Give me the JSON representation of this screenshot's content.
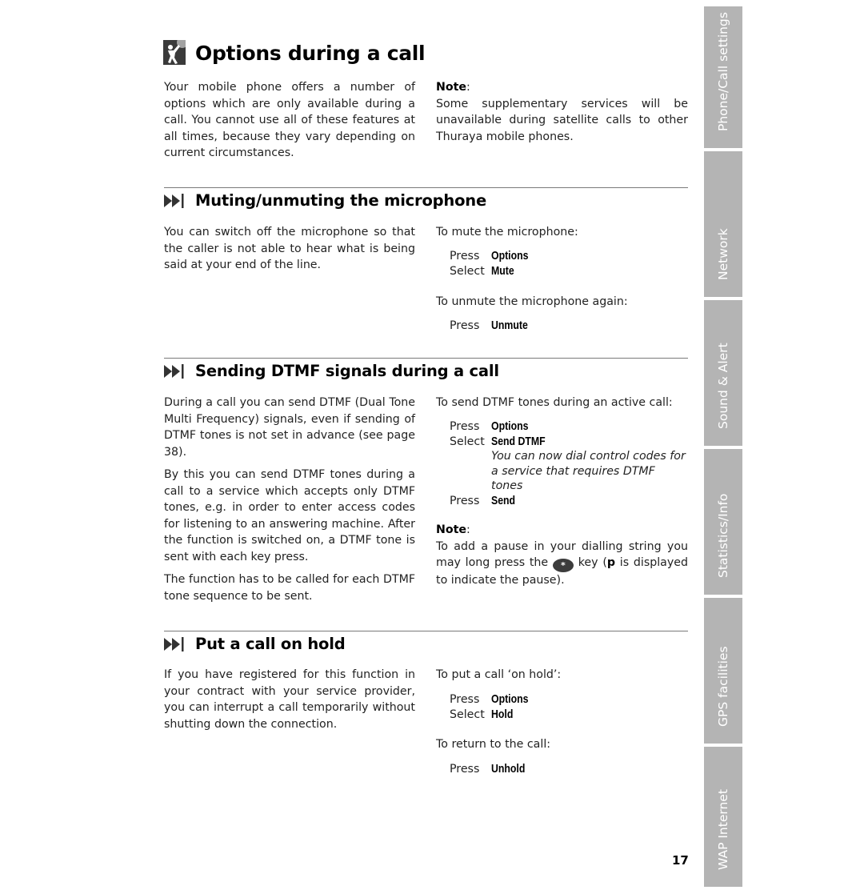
{
  "page": {
    "title": "Options during a call",
    "title_icon": "person-waving-icon",
    "page_number": "17",
    "intro": "Your mobile phone offers a number of options which are only available during a call. You cannot use all of these features at all times, because they vary depending on current circumstances.",
    "intro_note": {
      "label": "Note",
      "text": "Some supplementary services will be unavailable during satellite calls to other Thuraya mobile phones."
    }
  },
  "sections": [
    {
      "title": "Muting/unmuting the microphone",
      "icon": "fast-forward-end-icon",
      "body": [
        "You can switch off the microphone so that the caller is not able to hear what is being said at your end of the line."
      ],
      "procedures": [
        {
          "intro": "To mute the microphone:",
          "steps": [
            {
              "verb": "Press",
              "key": "Options"
            },
            {
              "verb": "Select",
              "key": "Mute"
            }
          ]
        },
        {
          "intro": "To unmute the microphone again:",
          "steps": [
            {
              "verb": "Press",
              "key": "Unmute"
            }
          ]
        }
      ]
    },
    {
      "title": "Sending DTMF signals during a call",
      "icon": "fast-forward-end-icon",
      "body": [
        "During a call you can send DTMF (Dual Tone Multi Frequency) signals, even if sending of DTMF tones is not set in advance (see page 38).",
        "By this you can send DTMF tones during a call to a service which accepts only DTMF tones, e.g. in order to enter access codes for listening to an answering machine. After the function is switched on, a DTMF tone is sent with each key press.",
        "The function has to be called for each DTMF tone sequence to be sent."
      ],
      "procedures": [
        {
          "intro": "To send DTMF tones during an active call:",
          "steps": [
            {
              "verb": "Press",
              "key": "Options"
            },
            {
              "verb": "Select",
              "key": "Send DTMF"
            },
            {
              "note": "You can now dial control codes for a service that requires DTMF tones"
            },
            {
              "verb": "Press",
              "key": "Send"
            }
          ]
        }
      ],
      "note": {
        "label": "Note",
        "text_before": "To add a pause in your dialling string you may long press the",
        "key_symbol": "*",
        "text_middle": "key (",
        "bold_char": "p",
        "text_after": "is displayed to indicate the pause)."
      }
    },
    {
      "title": "Put a call on hold",
      "icon": "fast-forward-end-icon",
      "body": [
        "If you have registered for this function in your contract with your service provider, you can interrupt a call temporarily without shutting down the connection."
      ],
      "procedures": [
        {
          "intro": "To put a call ‘on hold’:",
          "steps": [
            {
              "verb": "Press",
              "key": "Options"
            },
            {
              "verb": "Select",
              "key": "Hold"
            }
          ]
        },
        {
          "intro": "To return to the call:",
          "steps": [
            {
              "verb": "Press",
              "key": "Unhold"
            }
          ]
        }
      ]
    }
  ],
  "side_tabs": [
    {
      "label": "Phone/Call settings"
    },
    {
      "label": "Network"
    },
    {
      "label": "Sound & Alert"
    },
    {
      "label": "Statistics/Info"
    },
    {
      "label": "GPS facilities"
    },
    {
      "label": "WAP Internet"
    }
  ],
  "colors": {
    "tab_background": "#b4b4b4",
    "tab_text": "#ffffff",
    "rule": "#7a7a7a",
    "text": "#222222"
  }
}
